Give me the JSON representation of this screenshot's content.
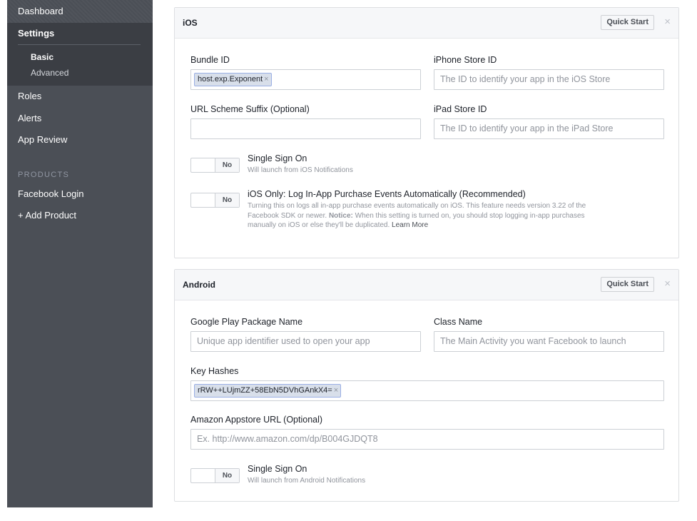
{
  "sidebar": {
    "dashboard": "Dashboard",
    "settings": "Settings",
    "basic": "Basic",
    "advanced": "Advanced",
    "roles": "Roles",
    "alerts": "Alerts",
    "app_review": "App Review",
    "products_heading": "PRODUCTS",
    "facebook_login": "Facebook Login",
    "add_product": "+ Add Product"
  },
  "ios": {
    "title": "iOS",
    "quick_start": "Quick Start",
    "close": "×",
    "bundle_id_label": "Bundle ID",
    "bundle_id_token": "host.exp.Exponent",
    "iphone_store_label": "iPhone Store ID",
    "iphone_store_placeholder": "The ID to identify your app in the iOS Store",
    "url_scheme_label": "URL Scheme Suffix (Optional)",
    "url_scheme_value": "",
    "ipad_store_label": "iPad Store ID",
    "ipad_store_placeholder": "The ID to identify your app in the iPad Store",
    "sso_toggle": "No",
    "sso_title": "Single Sign On",
    "sso_desc": "Will launch from iOS Notifications",
    "iap_toggle": "No",
    "iap_title": "iOS Only: Log In-App Purchase Events Automatically (Recommended)",
    "iap_desc_1": "Turning this on logs all in-app purchase events automatically on iOS. This feature needs version 3.22 of the",
    "iap_desc_2a": "Facebook SDK or newer. ",
    "iap_desc_notice": "Notice:",
    "iap_desc_2b": " When this setting is turned on, you should stop logging in-app purchases",
    "iap_desc_3": "manually on iOS or else they'll be duplicated. ",
    "learn_more": "Learn More"
  },
  "android": {
    "title": "Android",
    "quick_start": "Quick Start",
    "close": "×",
    "package_label": "Google Play Package Name",
    "package_placeholder": "Unique app identifier used to open your app",
    "class_label": "Class Name",
    "class_placeholder": "The Main Activity you want Facebook to launch",
    "key_hashes_label": "Key Hashes",
    "key_hash_token": "rRW++LUjmZZ+58EbN5DVhGAnkX4=",
    "amazon_label": "Amazon Appstore URL (Optional)",
    "amazon_placeholder": "Ex. http://www.amazon.com/dp/B004GJDQT8",
    "sso_toggle": "No",
    "sso_title": "Single Sign On",
    "sso_desc": "Will launch from Android Notifications"
  },
  "token_remove": "×"
}
